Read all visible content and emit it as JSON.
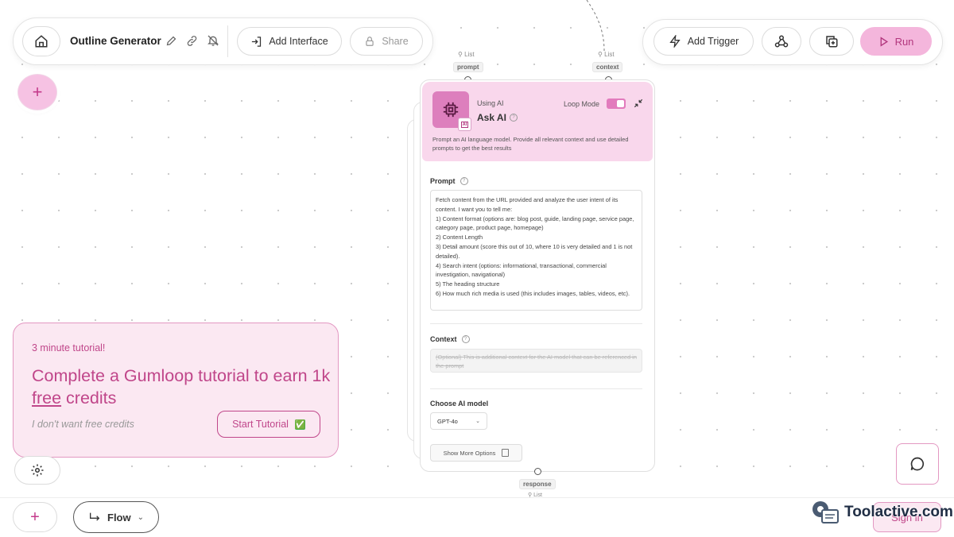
{
  "toolbar": {
    "title": "Outline Generator",
    "add_interface_label": "Add Interface",
    "share_label": "Share"
  },
  "right_toolbar": {
    "add_trigger_label": "Add Trigger",
    "run_label": "Run"
  },
  "ports": {
    "prompt_type": "List",
    "prompt_label": "prompt",
    "context_type": "List",
    "context_label": "context",
    "response_label": "response",
    "response_type": "List"
  },
  "node": {
    "subtitle": "Using AI",
    "title": "Ask AI",
    "loop_mode_label": "Loop Mode",
    "loop_mode_on": true,
    "badge": "AI",
    "description": "Prompt an AI language model. Provide all relevant context and use detailed prompts to get the best results",
    "prompt_label": "Prompt",
    "prompt_text": "Fetch content from the URL provided and analyze the user intent of its content. I want you to tell me:\n1) Content format (options are: blog post, guide, landing page, service page, category page, product page, homepage)\n2) Content Length\n3) Detail amount (score this out of 10, where 10 is very detailed and 1 is not detailed).\n4) Search intent (options: informational, transactional, commercial investigation, navigational)\n5) The heading structure\n6) How much rich media is used (this includes images, tables, videos, etc).",
    "context_label": "Context",
    "context_placeholder": "(Optional) This is additional context for the AI model that can be referenced in the prompt",
    "model_label": "Choose AI model",
    "model_value": "GPT-4o",
    "more_options_label": "Show More Options"
  },
  "tutorial": {
    "kicker": "3 minute tutorial!",
    "headline_part1": "Complete a Gumloop tutorial to earn 1k ",
    "headline_link": "free",
    "headline_part2": " credits",
    "dismiss_label": "I don't want free credits",
    "start_label": "Start Tutorial",
    "start_emoji": "✅"
  },
  "bottom": {
    "flow_label": "Flow",
    "sign_in_label": "Sign in"
  },
  "watermark": {
    "text": "Toolactive.com"
  },
  "colors": {
    "accent_pink": "#f4b6dc",
    "node_header": "#f9d7ec",
    "tutorial_bg": "#fbe8f2",
    "tutorial_text": "#c0468a"
  }
}
